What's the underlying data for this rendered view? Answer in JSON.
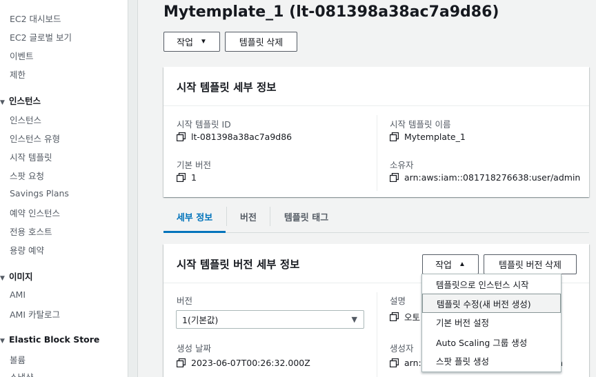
{
  "sidebar": {
    "items_top": [
      "EC2 대시보드",
      "EC2 글로벌 보기",
      "이벤트",
      "제한"
    ],
    "sections": [
      {
        "title": "인스턴스",
        "items": [
          "인스턴스",
          "인스턴스 유형",
          "시작 템플릿",
          "스팟 요청",
          "Savings Plans",
          "예약 인스턴스",
          "전용 호스트",
          "용량 예약"
        ]
      },
      {
        "title": "이미지",
        "items": [
          "AMI",
          "AMI 카탈로그"
        ]
      },
      {
        "title": "Elastic Block Store",
        "items": [
          "볼륨",
          "스냅샷"
        ]
      }
    ]
  },
  "header": {
    "title": "Mytemplate_1 (lt-081398a38ac7a9d86)",
    "actions_label": "작업",
    "delete_label": "템플릿 삭제"
  },
  "details_panel": {
    "title": "시작 템플릿 세부 정보",
    "fields": {
      "id_label": "시작 템플릿 ID",
      "id_value": "lt-081398a38ac7a9d86",
      "name_label": "시작 템플릿 이름",
      "name_value": "Mytemplate_1",
      "default_version_label": "기본 버전",
      "default_version_value": "1",
      "owner_label": "소유자",
      "owner_value": "arn:aws:iam::081718276638:user/admin"
    }
  },
  "tabs": [
    {
      "label": "세부 정보",
      "active": true
    },
    {
      "label": "버전",
      "active": false
    },
    {
      "label": "템플릿 태그",
      "active": false
    }
  ],
  "version_panel": {
    "title": "시작 템플릿 버전 세부 정보",
    "actions_label": "작업",
    "delete_version_label": "템플릿 버전 삭제",
    "version_label": "버전",
    "version_selected": "1(기본값)",
    "description_label": "설명",
    "description_value": "오토",
    "created_label": "생성 날짜",
    "created_value": "2023-06-07T00:26:32.000Z",
    "creator_label": "생성자",
    "creator_value_start": "arn:",
    "creator_value_end": "n"
  },
  "dropdown": {
    "items": [
      "템플릿으로 인스턴스 시작",
      "템플릿 수정(새 버전 생성)",
      "기본 버전 설정",
      "Auto Scaling 그룹 생성",
      "스팟 플릿 생성"
    ],
    "hovered_index": 1
  },
  "colors": {
    "accent": "#0073bb",
    "text": "#16191f",
    "muted": "#545b64",
    "background": "#f2f3f3"
  }
}
